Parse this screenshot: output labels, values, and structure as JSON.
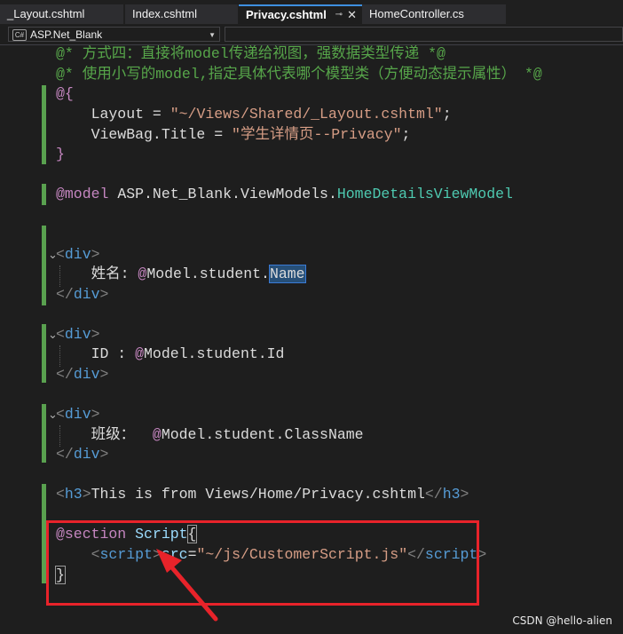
{
  "tabs": [
    {
      "label": "_Layout.cshtml"
    },
    {
      "label": "Index.cshtml"
    },
    {
      "label": "Privacy.cshtml",
      "pin_icon": "pin-icon",
      "close_icon": "close-icon"
    },
    {
      "label": "HomeController.cs"
    }
  ],
  "navbar": {
    "project": "ASP.Net_Blank",
    "project_icon_text": "C#",
    "project_icon": "csharp-project-icon"
  },
  "code": {
    "l1": {
      "c1": "@* 方式四：直接将model传递给视图，强数据类型传递 *@"
    },
    "l2": {
      "c1": "@* 使用小写的model,指定具体代表哪个模型类（方便动态提示属性） *@"
    },
    "l3": {
      "a": "@{"
    },
    "l4": {
      "a": "    Layout = ",
      "b": "\"~/Views/Shared/_Layout.cshtml\"",
      "c": ";"
    },
    "l5": {
      "a": "    ViewBag.Title = ",
      "b": "\"学生详情页--Privacy\"",
      "c": ";"
    },
    "l6": {
      "a": "}"
    },
    "l7": {
      "a": "@model",
      "b": " ASP.Net_Blank.ViewModels.",
      "c": "HomeDetailsViewModel"
    },
    "l8": {
      "a": "<",
      "b": "div",
      "c": ">"
    },
    "l9": {
      "a": "    姓名: ",
      "b": "@",
      "c": "Model.student.",
      "d": "Name"
    },
    "l10": {
      "a": "</",
      "b": "div",
      "c": ">"
    },
    "l11": {
      "a": "<",
      "b": "div",
      "c": ">"
    },
    "l12": {
      "a": "    ID : ",
      "b": "@",
      "c": "Model.student.Id"
    },
    "l13": {
      "a": "</",
      "b": "div",
      "c": ">"
    },
    "l14": {
      "a": "<",
      "b": "div",
      "c": ">"
    },
    "l15": {
      "a": "    班级：  ",
      "b": "@",
      "c": "Model.student.ClassName"
    },
    "l16": {
      "a": "</",
      "b": "div",
      "c": ">"
    },
    "l17": {
      "a": "<",
      "b": "h3",
      "c": ">",
      "d": "This is from Views/Home/Privacy.cshtml",
      "e": "</",
      "f": "h3",
      "g": ">"
    },
    "l18": {
      "a": "@section",
      "b": " Script",
      "c": "{"
    },
    "l19": {
      "a": "    ",
      "b": "<",
      "c": "script",
      "d": ">",
      "e": "src",
      "f": "=",
      "g": "\"~/js/CustomerScript.js\"",
      "h": "</",
      "i": "script",
      "j": ">"
    },
    "l20": {
      "a": "}"
    }
  },
  "annotation": {
    "arrow_color": "#e8232a",
    "box_color": "#e8232a"
  },
  "watermark": "CSDN @hello-alien",
  "colors": {
    "comment": "#57a64a",
    "razor": "#c586c0",
    "tag": "#569cd6",
    "string": "#d69d85",
    "type": "#4ec9b0",
    "gutter_change": "#59a14f"
  }
}
